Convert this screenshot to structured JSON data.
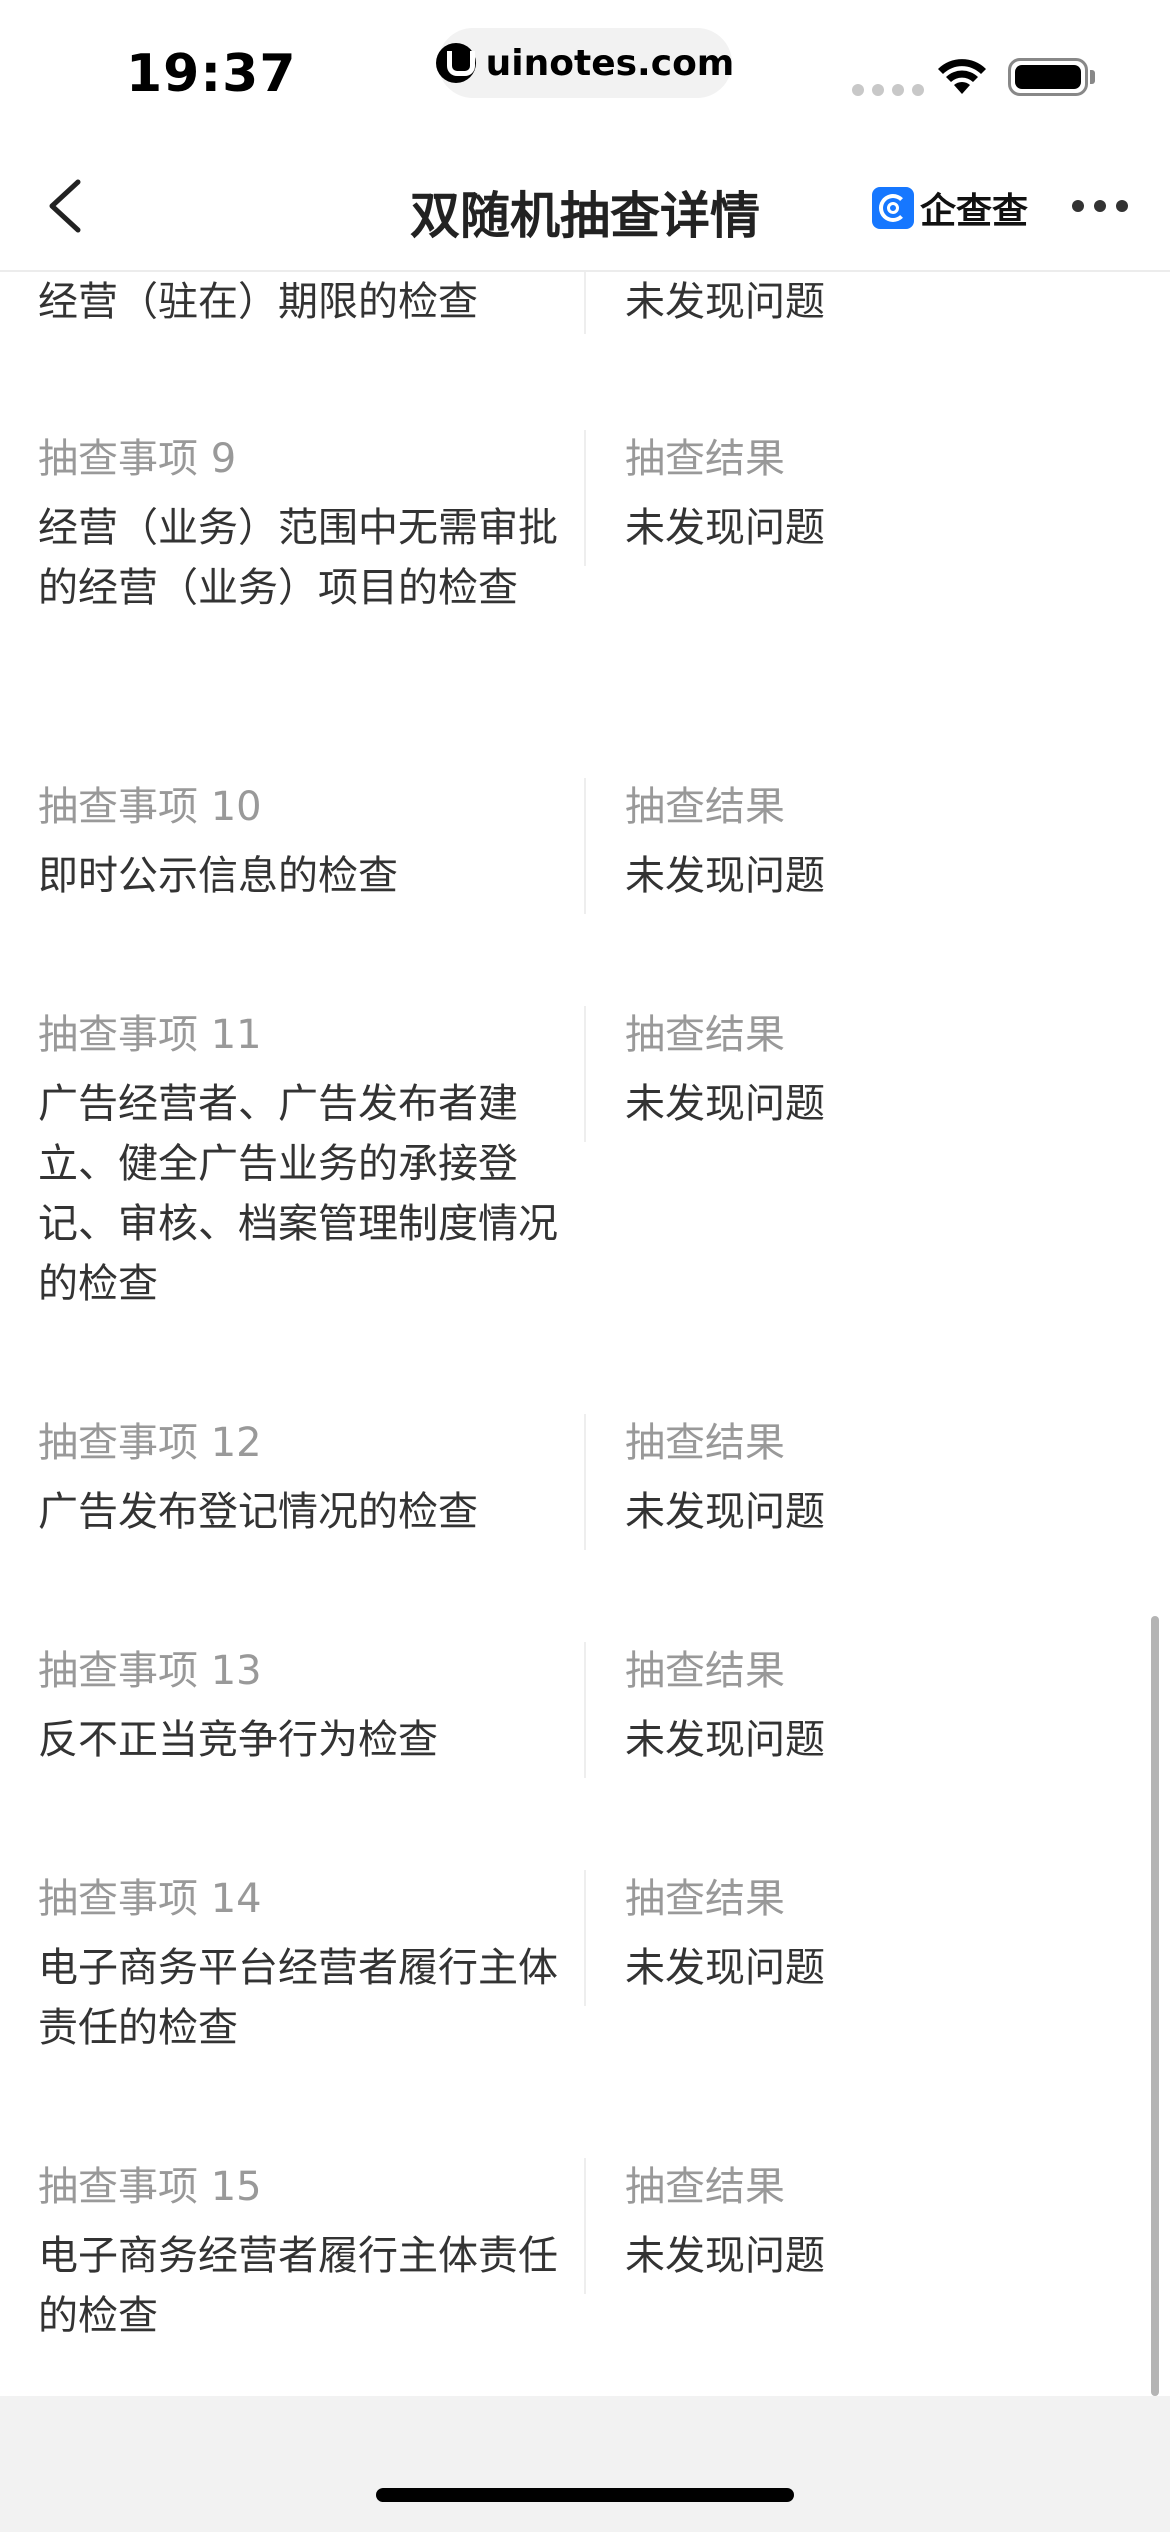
{
  "status_bar": {
    "time": "19:37",
    "url": "uinotes.com",
    "url_icon": "uinotes-logo-icon",
    "wifi_icon": "wifi-icon",
    "battery_icon": "battery-icon"
  },
  "nav": {
    "back_icon": "chevron-left-icon",
    "title": "双随机抽查详情",
    "brand_icon": "qichacha-logo-icon",
    "brand_name": "企查查",
    "more_icon": "more-dots-icon"
  },
  "items": [
    {
      "label": "",
      "value": "经营（驻在）期限的检查",
      "result_label": "",
      "result_value": "未发现问题"
    },
    {
      "label": "抽查事项 9",
      "value": "经营（业务）范围中无需审批的经营（业务）项目的检查",
      "result_label": "抽查结果",
      "result_value": "未发现问题"
    },
    {
      "label": "抽查事项 10",
      "value": "即时公示信息的检查",
      "result_label": "抽查结果",
      "result_value": "未发现问题"
    },
    {
      "label": "抽查事项 11",
      "value": "广告经营者、广告发布者建立、健全广告业务的承接登记、审核、档案管理制度情况的检查",
      "result_label": "抽查结果",
      "result_value": "未发现问题"
    },
    {
      "label": "抽查事项 12",
      "value": "广告发布登记情况的检查",
      "result_label": "抽查结果",
      "result_value": "未发现问题"
    },
    {
      "label": "抽查事项 13",
      "value": "反不正当竞争行为检查",
      "result_label": "抽查结果",
      "result_value": "未发现问题"
    },
    {
      "label": "抽查事项 14",
      "value": "电子商务平台经营者履行主体责任的检查",
      "result_label": "抽查结果",
      "result_value": "未发现问题"
    },
    {
      "label": "抽查事项 15",
      "value": "电子商务经营者履行主体责任的检查",
      "result_label": "抽查结果",
      "result_value": "未发现问题"
    }
  ]
}
